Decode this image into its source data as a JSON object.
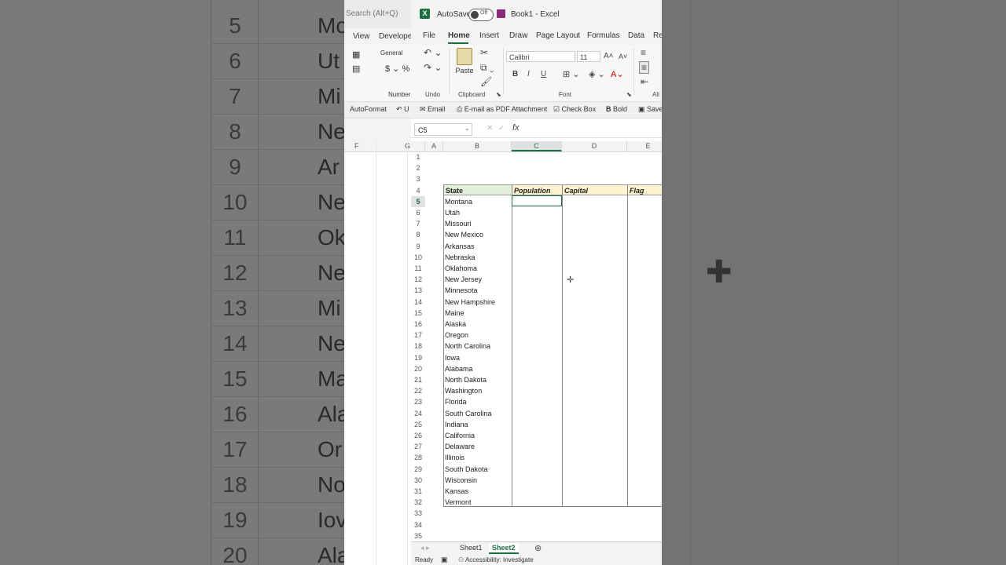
{
  "background": {
    "row_numbers": [
      "5",
      "6",
      "7",
      "8",
      "9",
      "10",
      "11",
      "12",
      "13",
      "14",
      "15",
      "16",
      "17",
      "18",
      "19",
      "20"
    ],
    "row_texts": [
      "Mo",
      "Ut",
      "Mi",
      "Ne",
      "Ar",
      "Ne",
      "Ok",
      "Ne",
      "Mi",
      "Ne",
      "Ma",
      "Ala",
      "Or",
      "No",
      "Iov",
      "Ala"
    ],
    "cross_glyph": "✚"
  },
  "left_panel": {
    "search_placeholder": "Search (Alt+Q)",
    "tabs": [
      "View",
      "Develope"
    ],
    "number_format": "General",
    "number_group": "Number",
    "qa_autoformat": "AutoFormat",
    "qa_undo": "U",
    "col_f": "F",
    "col_g": "G"
  },
  "titlebar": {
    "app_logo": "X",
    "autosave_label": "AutoSave",
    "autosave_state": "Off",
    "doc_title": "Book1  -  Excel"
  },
  "tabs": [
    "File",
    "Home",
    "Insert",
    "Draw",
    "Page Layout",
    "Formulas",
    "Data",
    "Re"
  ],
  "active_tab": "Home",
  "ribbon": {
    "undo_label": "Undo",
    "clipboard_label": "Clipboard",
    "font_label": "Font",
    "align_label": "Ali",
    "paste_label": "Paste",
    "font_name": "Calibri",
    "font_size": "11",
    "bold": "B",
    "italic": "I",
    "underline": "U"
  },
  "quick_access": {
    "email": "Email",
    "email_pdf": "E-mail as PDF Attachment",
    "check_box": "Check Box",
    "bold": "Bold",
    "save": "Save"
  },
  "formula_bar": {
    "name_box": "C5",
    "fx": "fx",
    "cancel": "✕",
    "enter": "✓"
  },
  "grid": {
    "columns": [
      "A",
      "B",
      "C",
      "D",
      "E"
    ],
    "selected_column": "C",
    "selected_row": "5",
    "headers": {
      "state": "State",
      "population": "Population",
      "capital": "Capital",
      "flag": "Flag"
    },
    "states": [
      "Montana",
      "Utah",
      "Missouri",
      "New Mexico",
      "Arkansas",
      "Nebraska",
      "Oklahoma",
      "New Jersey",
      "Minnesota",
      "New Hampshire",
      "Maine",
      "Alaska",
      "Oregon",
      "North Carolina",
      "Iowa",
      "Alabama",
      "North Dakota",
      "Washington",
      "Florida",
      "South Carolina",
      "Indiana",
      "California",
      "Delaware",
      "Illinois",
      "South Dakota",
      "Wisconsin",
      "Kansas",
      "Vermont"
    ],
    "row_numbers": [
      "1",
      "2",
      "3",
      "4",
      "5",
      "6",
      "7",
      "8",
      "9",
      "10",
      "11",
      "12",
      "13",
      "14",
      "15",
      "16",
      "17",
      "18",
      "19",
      "20",
      "21",
      "22",
      "23",
      "24",
      "25",
      "26",
      "27",
      "28",
      "29",
      "30",
      "31",
      "32",
      "33",
      "34",
      "35"
    ]
  },
  "sheets": [
    "Sheet1",
    "Sheet2"
  ],
  "active_sheet": "Sheet2",
  "status": {
    "ready": "Ready",
    "accessibility": "Accessibility: Investigate"
  },
  "colors": {
    "accent": "#1d6f42",
    "header_fill": "#fdf3d0",
    "state_header_fill": "#e4efdb"
  }
}
